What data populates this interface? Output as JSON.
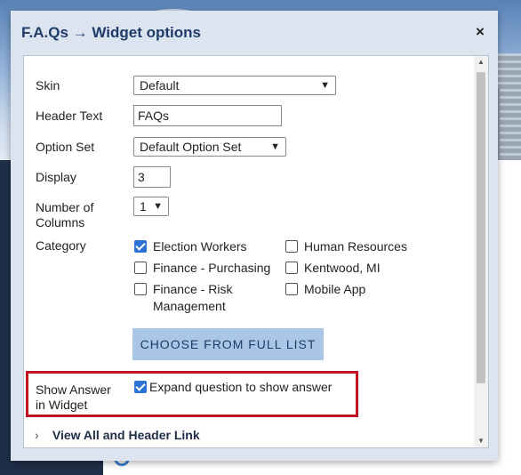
{
  "dialog": {
    "title": "F.A.Qs → Widget options",
    "close_label": "×"
  },
  "form": {
    "skin": {
      "label": "Skin",
      "value": "Default"
    },
    "header_text": {
      "label": "Header Text",
      "value": "FAQs"
    },
    "option_set": {
      "label": "Option Set",
      "value": "Default Option Set"
    },
    "display": {
      "label": "Display",
      "value": "3"
    },
    "number_of_columns": {
      "label_line1": "Number of",
      "label_line2": "Columns",
      "value": "1"
    },
    "category": {
      "label": "Category",
      "options": [
        {
          "label_line1": "Election Workers",
          "label_line2": "",
          "checked": true
        },
        {
          "label_line1": "Finance - Purchasing",
          "label_line2": "",
          "checked": false
        },
        {
          "label_line1": "Finance - Risk",
          "label_line2": "Management",
          "checked": false
        },
        {
          "label_line1": "Human Resources",
          "label_line2": "",
          "checked": false
        },
        {
          "label_line1": "Kentwood, MI",
          "label_line2": "",
          "checked": false
        },
        {
          "label_line1": "Mobile App",
          "label_line2": "",
          "checked": false
        }
      ]
    },
    "choose_button_label": "CHOOSE FROM FULL LIST",
    "show_answer": {
      "label_line1": "Show Answer",
      "label_line2": "in Widget",
      "checkbox_label": "Expand question to show answer",
      "checked": true
    },
    "view_all_link_label": "View All and Header Link"
  },
  "colors": {
    "title": "#1f3b68",
    "checkbox_checked": "#2a72d4",
    "highlight_border": "#c1121f",
    "choose_button_bg": "#a9c6e6",
    "sidebar_bg": "#1f2e48"
  },
  "icons": {
    "close": "close-icon",
    "select_chevron": "chevron-down-icon",
    "expand": "chevron-right-icon"
  }
}
